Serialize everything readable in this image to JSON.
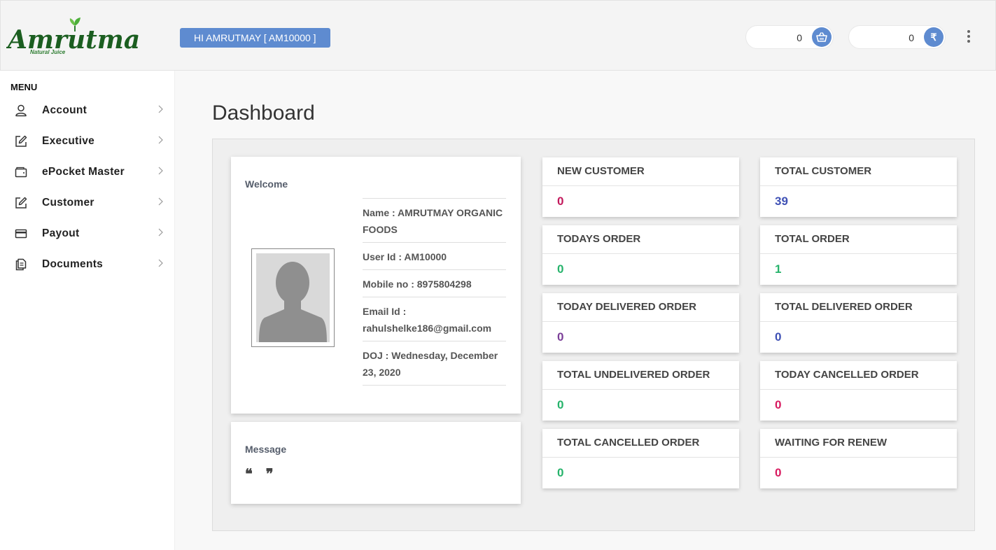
{
  "header": {
    "logo_text": "Amrutmay",
    "logo_tagline": "Natural Juice",
    "greeting": "HI AMRUTMAY [ AM10000 ]",
    "wallet_basket": {
      "value": "0",
      "icon": "basket-icon"
    },
    "wallet_rupee": {
      "value": "0",
      "icon": "rupee-icon",
      "symbol": "₹"
    },
    "menu_icon": "kebab-icon"
  },
  "sidebar": {
    "title": "MENU",
    "items": [
      {
        "label": "Account",
        "icon": "user-icon"
      },
      {
        "label": "Executive",
        "icon": "edit-icon"
      },
      {
        "label": "ePocket Master",
        "icon": "wallet-icon"
      },
      {
        "label": "Customer",
        "icon": "edit-icon"
      },
      {
        "label": "Payout",
        "icon": "card-icon"
      },
      {
        "label": "Documents",
        "icon": "documents-icon"
      }
    ]
  },
  "main": {
    "title": "Dashboard",
    "welcome": {
      "title": "Welcome",
      "name": "Name : AMRUTMAY ORGANIC FOODS",
      "user_id": "User Id : AM10000",
      "mobile": "Mobile no : 8975804298",
      "email": "Email Id : rahulshelke186@gmail.com",
      "doj": "DOJ : Wednesday, December 23, 2020"
    },
    "message": {
      "title": "Message",
      "quotes": "❝ ❞"
    },
    "stats": [
      {
        "title": "NEW CUSTOMER",
        "value": "0",
        "color": "#c2185b"
      },
      {
        "title": "TOTAL CUSTOMER",
        "value": "39",
        "color": "#3f51b5"
      },
      {
        "title": "TODAYS ORDER",
        "value": "0",
        "color": "#26b36b"
      },
      {
        "title": "TOTAL ORDER",
        "value": "1",
        "color": "#26b36b"
      },
      {
        "title": "TODAY DELIVERED ORDER",
        "value": "0",
        "color": "#7b3f98"
      },
      {
        "title": "TOTAL DELIVERED ORDER",
        "value": "0",
        "color": "#3f51b5"
      },
      {
        "title": "TOTAL UNDELIVERED ORDER",
        "value": "0",
        "color": "#26b36b"
      },
      {
        "title": "TODAY CANCELLED ORDER",
        "value": "0",
        "color": "#d81b60"
      },
      {
        "title": "TOTAL CANCELLED ORDER",
        "value": "0",
        "color": "#26b36b"
      },
      {
        "title": "WAITING FOR RENEW",
        "value": "0",
        "color": "#d81b60"
      }
    ]
  }
}
